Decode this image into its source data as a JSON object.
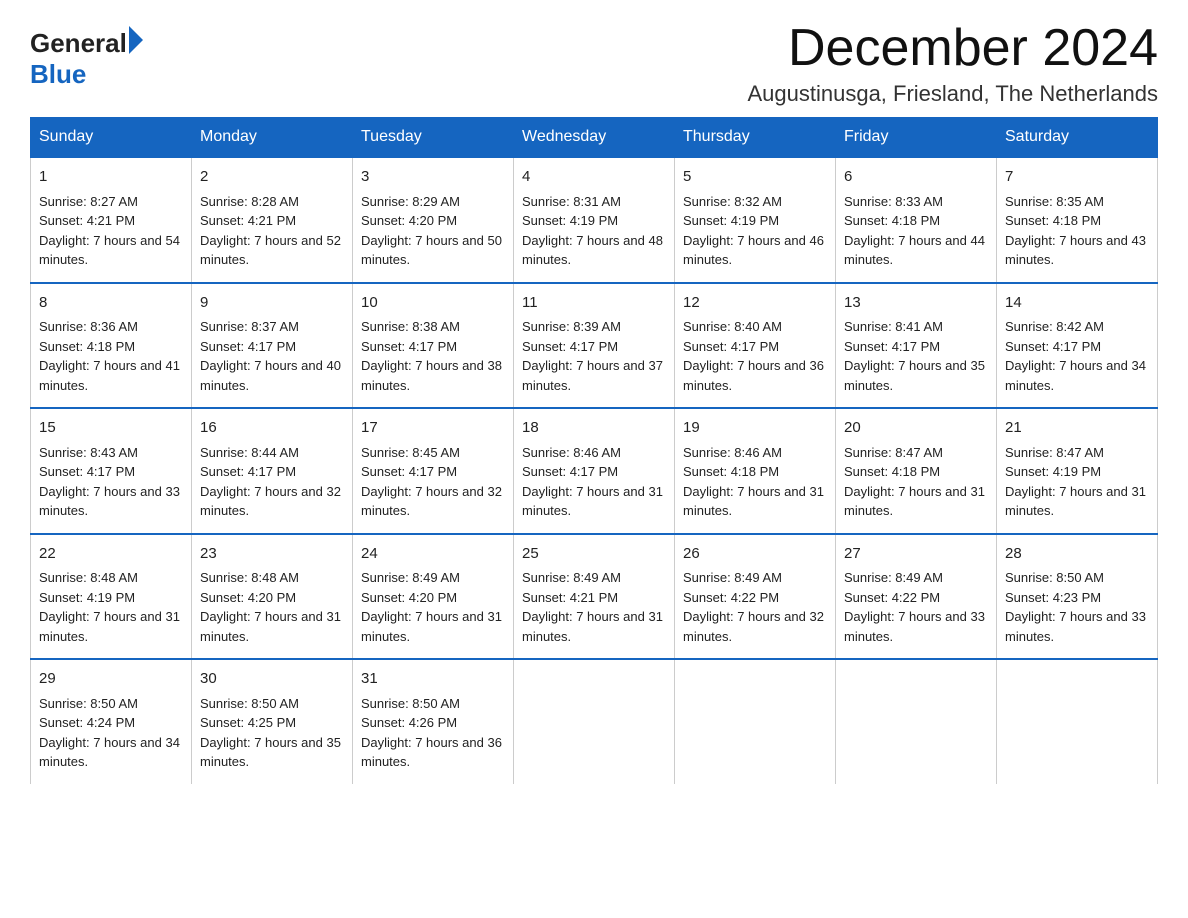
{
  "header": {
    "logo_general": "General",
    "logo_blue": "Blue",
    "title": "December 2024",
    "location": "Augustinusga, Friesland, The Netherlands"
  },
  "weekdays": [
    "Sunday",
    "Monday",
    "Tuesday",
    "Wednesday",
    "Thursday",
    "Friday",
    "Saturday"
  ],
  "weeks": [
    [
      {
        "day": "1",
        "sunrise": "8:27 AM",
        "sunset": "4:21 PM",
        "daylight": "7 hours and 54 minutes."
      },
      {
        "day": "2",
        "sunrise": "8:28 AM",
        "sunset": "4:21 PM",
        "daylight": "7 hours and 52 minutes."
      },
      {
        "day": "3",
        "sunrise": "8:29 AM",
        "sunset": "4:20 PM",
        "daylight": "7 hours and 50 minutes."
      },
      {
        "day": "4",
        "sunrise": "8:31 AM",
        "sunset": "4:19 PM",
        "daylight": "7 hours and 48 minutes."
      },
      {
        "day": "5",
        "sunrise": "8:32 AM",
        "sunset": "4:19 PM",
        "daylight": "7 hours and 46 minutes."
      },
      {
        "day": "6",
        "sunrise": "8:33 AM",
        "sunset": "4:18 PM",
        "daylight": "7 hours and 44 minutes."
      },
      {
        "day": "7",
        "sunrise": "8:35 AM",
        "sunset": "4:18 PM",
        "daylight": "7 hours and 43 minutes."
      }
    ],
    [
      {
        "day": "8",
        "sunrise": "8:36 AM",
        "sunset": "4:18 PM",
        "daylight": "7 hours and 41 minutes."
      },
      {
        "day": "9",
        "sunrise": "8:37 AM",
        "sunset": "4:17 PM",
        "daylight": "7 hours and 40 minutes."
      },
      {
        "day": "10",
        "sunrise": "8:38 AM",
        "sunset": "4:17 PM",
        "daylight": "7 hours and 38 minutes."
      },
      {
        "day": "11",
        "sunrise": "8:39 AM",
        "sunset": "4:17 PM",
        "daylight": "7 hours and 37 minutes."
      },
      {
        "day": "12",
        "sunrise": "8:40 AM",
        "sunset": "4:17 PM",
        "daylight": "7 hours and 36 minutes."
      },
      {
        "day": "13",
        "sunrise": "8:41 AM",
        "sunset": "4:17 PM",
        "daylight": "7 hours and 35 minutes."
      },
      {
        "day": "14",
        "sunrise": "8:42 AM",
        "sunset": "4:17 PM",
        "daylight": "7 hours and 34 minutes."
      }
    ],
    [
      {
        "day": "15",
        "sunrise": "8:43 AM",
        "sunset": "4:17 PM",
        "daylight": "7 hours and 33 minutes."
      },
      {
        "day": "16",
        "sunrise": "8:44 AM",
        "sunset": "4:17 PM",
        "daylight": "7 hours and 32 minutes."
      },
      {
        "day": "17",
        "sunrise": "8:45 AM",
        "sunset": "4:17 PM",
        "daylight": "7 hours and 32 minutes."
      },
      {
        "day": "18",
        "sunrise": "8:46 AM",
        "sunset": "4:17 PM",
        "daylight": "7 hours and 31 minutes."
      },
      {
        "day": "19",
        "sunrise": "8:46 AM",
        "sunset": "4:18 PM",
        "daylight": "7 hours and 31 minutes."
      },
      {
        "day": "20",
        "sunrise": "8:47 AM",
        "sunset": "4:18 PM",
        "daylight": "7 hours and 31 minutes."
      },
      {
        "day": "21",
        "sunrise": "8:47 AM",
        "sunset": "4:19 PM",
        "daylight": "7 hours and 31 minutes."
      }
    ],
    [
      {
        "day": "22",
        "sunrise": "8:48 AM",
        "sunset": "4:19 PM",
        "daylight": "7 hours and 31 minutes."
      },
      {
        "day": "23",
        "sunrise": "8:48 AM",
        "sunset": "4:20 PM",
        "daylight": "7 hours and 31 minutes."
      },
      {
        "day": "24",
        "sunrise": "8:49 AM",
        "sunset": "4:20 PM",
        "daylight": "7 hours and 31 minutes."
      },
      {
        "day": "25",
        "sunrise": "8:49 AM",
        "sunset": "4:21 PM",
        "daylight": "7 hours and 31 minutes."
      },
      {
        "day": "26",
        "sunrise": "8:49 AM",
        "sunset": "4:22 PM",
        "daylight": "7 hours and 32 minutes."
      },
      {
        "day": "27",
        "sunrise": "8:49 AM",
        "sunset": "4:22 PM",
        "daylight": "7 hours and 33 minutes."
      },
      {
        "day": "28",
        "sunrise": "8:50 AM",
        "sunset": "4:23 PM",
        "daylight": "7 hours and 33 minutes."
      }
    ],
    [
      {
        "day": "29",
        "sunrise": "8:50 AM",
        "sunset": "4:24 PM",
        "daylight": "7 hours and 34 minutes."
      },
      {
        "day": "30",
        "sunrise": "8:50 AM",
        "sunset": "4:25 PM",
        "daylight": "7 hours and 35 minutes."
      },
      {
        "day": "31",
        "sunrise": "8:50 AM",
        "sunset": "4:26 PM",
        "daylight": "7 hours and 36 minutes."
      },
      null,
      null,
      null,
      null
    ]
  ]
}
